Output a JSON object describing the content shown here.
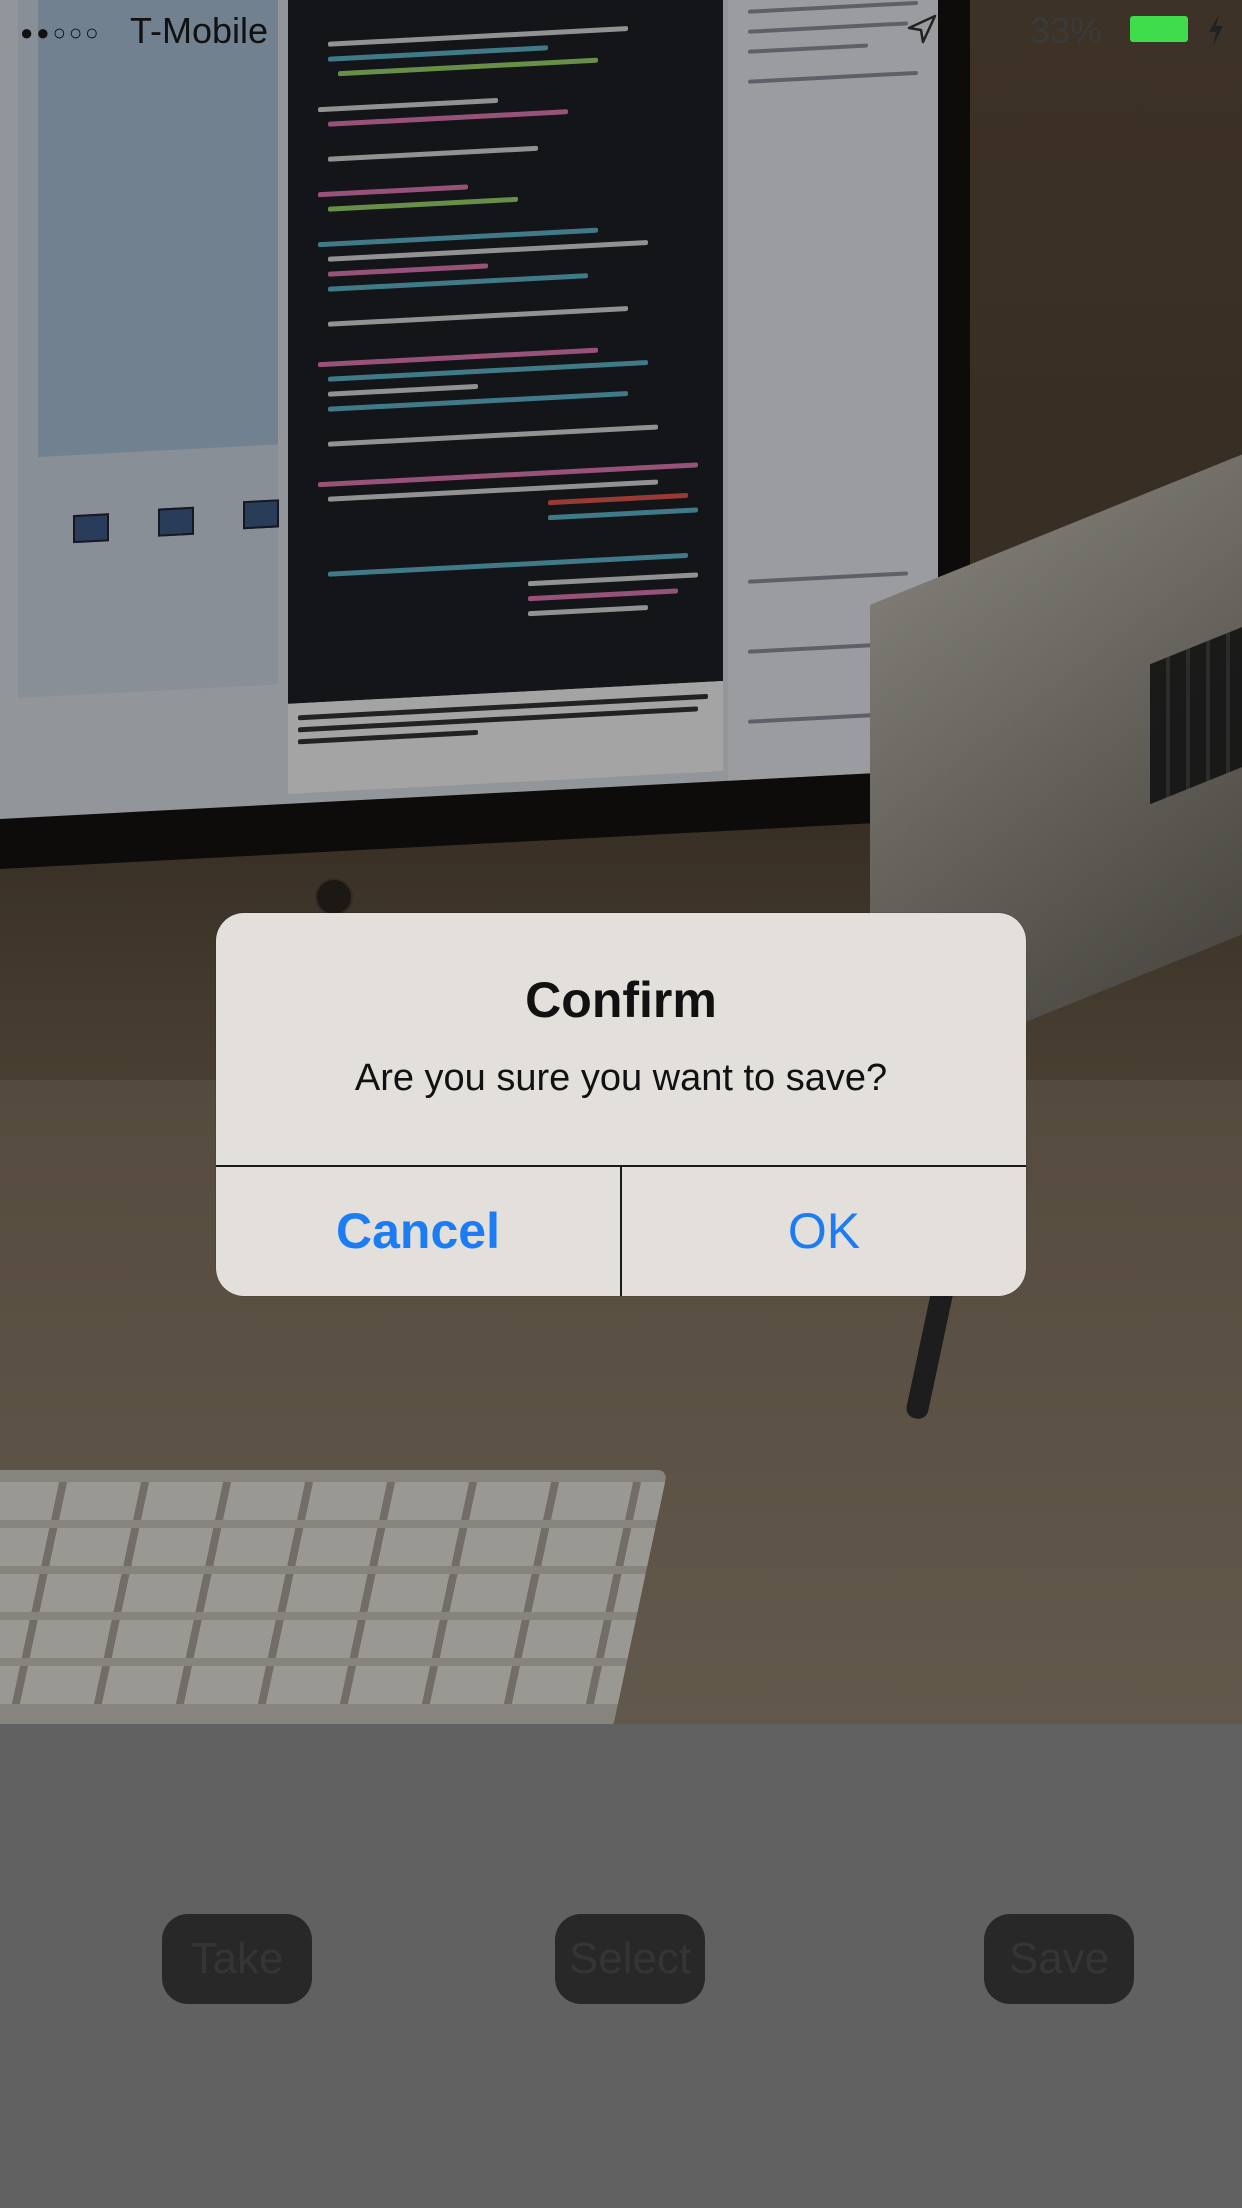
{
  "status_bar": {
    "signal": "●●○○○",
    "carrier": "T-Mobile",
    "battery_percent": "33%",
    "icons": [
      "location-arrow-icon",
      "battery-icon",
      "charging-bolt-icon"
    ],
    "battery_color": "#3fdc4c"
  },
  "alert": {
    "title": "Confirm",
    "message": "Are you sure you want to save?",
    "cancel_label": "Cancel",
    "ok_label": "OK",
    "button_color": "#1c7cf4"
  },
  "toolbar": {
    "take_label": "Take",
    "select_label": "Select",
    "save_label": "Save"
  }
}
